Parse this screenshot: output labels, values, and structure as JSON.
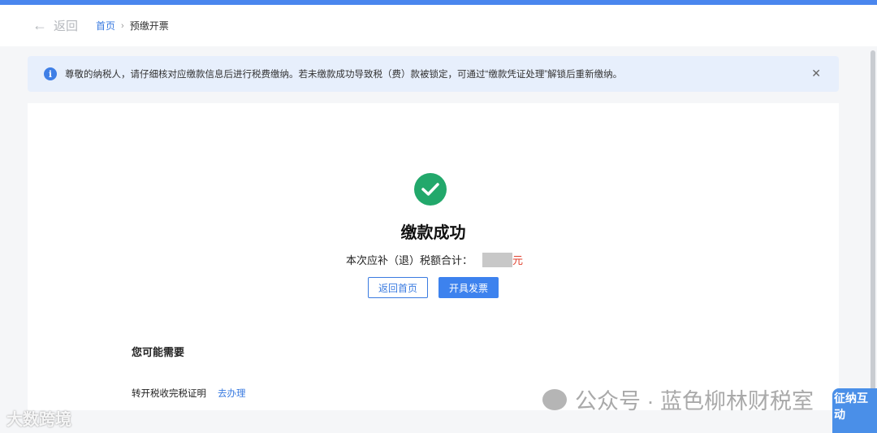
{
  "header": {
    "back_label": "返回",
    "breadcrumb": {
      "home": "首页",
      "current": "预缴开票"
    }
  },
  "alert": {
    "text": "尊敬的纳税人，请仔细核对应缴款信息后进行税费缴纳。若未缴款成功导致税（费）款被锁定，可通过“缴款凭证处理”解锁后重新缴纳。"
  },
  "result": {
    "title": "缴款成功",
    "sum_label": "本次应补（退）税额合计：",
    "unit": "元",
    "buttons": {
      "home": "返回首页",
      "invoice": "开具发票"
    }
  },
  "suggest": {
    "title": "您可能需要",
    "items": [
      {
        "label": "转开税收完税证明",
        "action": "去办理"
      }
    ]
  },
  "watermarks": {
    "left": "大数跨境",
    "right": "公众号 · 蓝色柳林财税室",
    "mascot": "征纳互动"
  }
}
